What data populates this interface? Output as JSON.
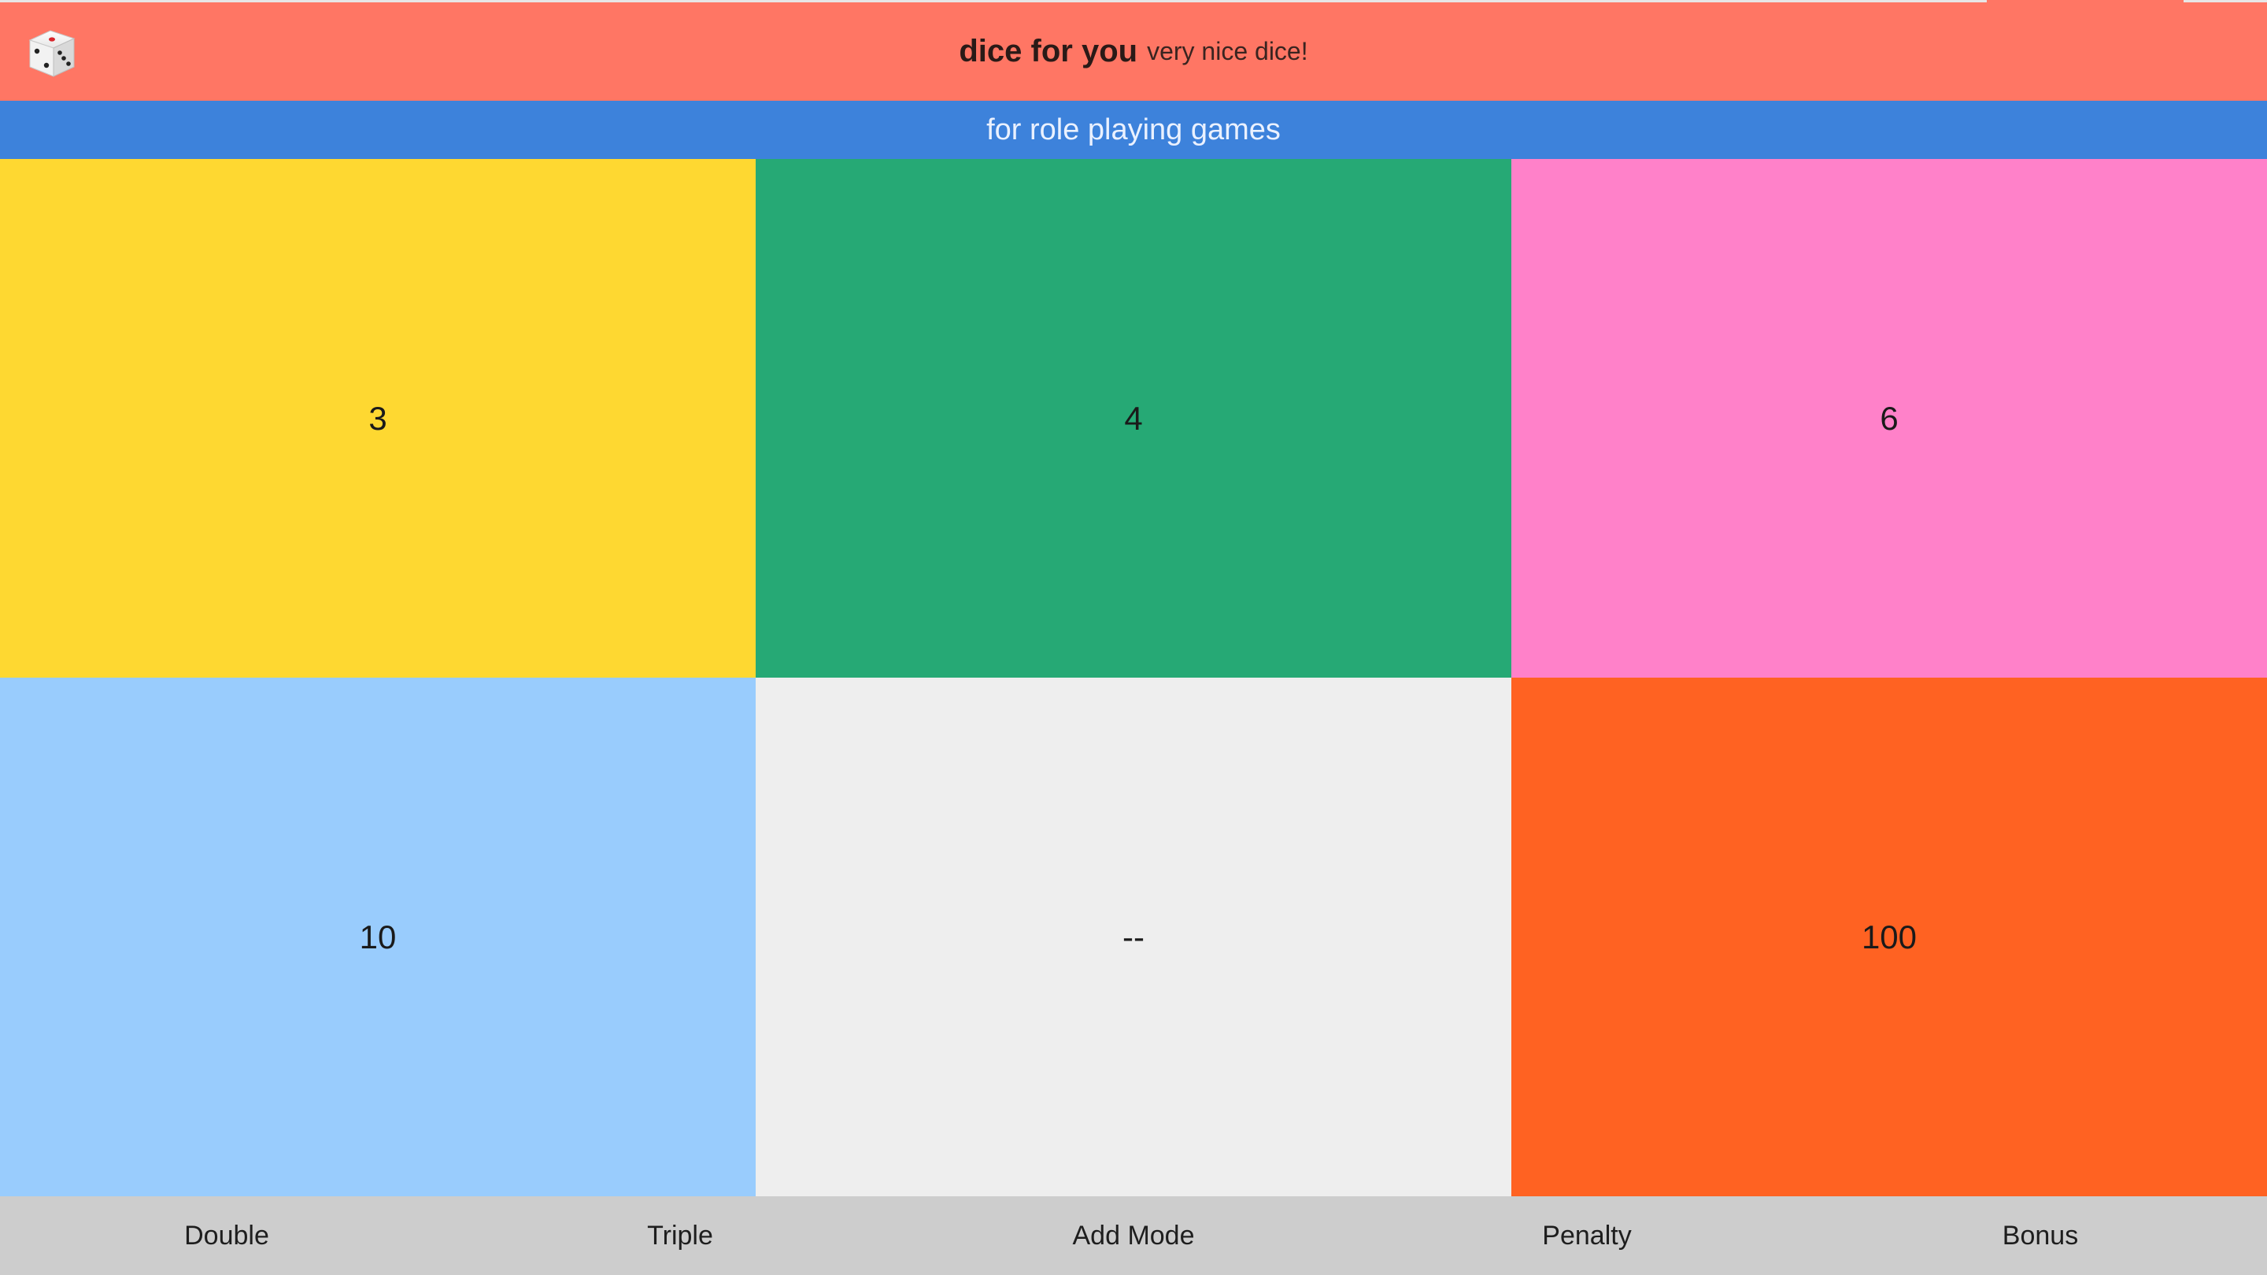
{
  "header": {
    "title": "dice for you",
    "tagline": "very nice dice!",
    "icon": "die-icon",
    "background": "#ff7664"
  },
  "subheader": {
    "text": "for role playing games",
    "background": "#3d82db"
  },
  "dice": [
    {
      "label": "3",
      "color": "#fed831"
    },
    {
      "label": "4",
      "color": "#26a975"
    },
    {
      "label": "6",
      "color": "#ff81c9"
    },
    {
      "label": "10",
      "color": "#99ccfd"
    },
    {
      "label": "--",
      "color": "#eeeeee"
    },
    {
      "label": "100",
      "color": "#ff6222"
    }
  ],
  "toolbar": {
    "background": "#cdcdcd",
    "buttons": [
      {
        "label": "Double"
      },
      {
        "label": "Triple"
      },
      {
        "label": "Add Mode"
      },
      {
        "label": "Penalty"
      },
      {
        "label": "Bonus"
      }
    ]
  }
}
